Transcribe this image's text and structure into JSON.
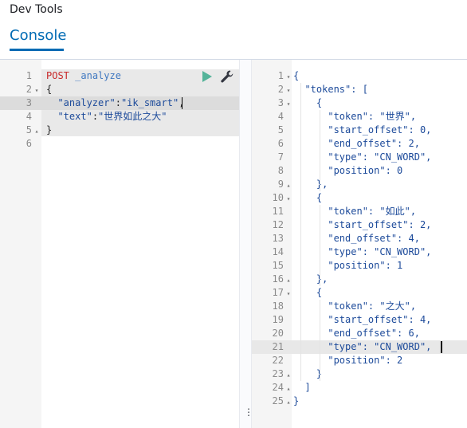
{
  "app": {
    "title": "Dev Tools"
  },
  "tabs": [
    {
      "label": "Console",
      "active": true
    }
  ],
  "request_editor": {
    "line_numbers": [
      "1",
      "2",
      "3",
      "4",
      "5",
      "6"
    ],
    "method": "POST",
    "endpoint": "_analyze",
    "line2": "{",
    "line3_key": "\"analyzer\"",
    "line3_sep": ":",
    "line3_val": "\"ik_smart\"",
    "line3_end": ",",
    "line4_key": "\"text\"",
    "line4_sep": ":",
    "line4_val": "\"世界如此之大\"",
    "line5": "}",
    "actions": {
      "run_icon": "play-icon",
      "settings_icon": "wrench-icon"
    }
  },
  "response_editor": {
    "line_numbers": [
      "1",
      "2",
      "3",
      "4",
      "5",
      "6",
      "7",
      "8",
      "9",
      "10",
      "11",
      "12",
      "13",
      "14",
      "15",
      "16",
      "17",
      "18",
      "19",
      "20",
      "21",
      "22",
      "23",
      "24",
      "25"
    ],
    "lines": [
      "{",
      "  \"tokens\": [",
      "    {",
      "      \"token\": \"世界\",",
      "      \"start_offset\": 0,",
      "      \"end_offset\": 2,",
      "      \"type\": \"CN_WORD\",",
      "      \"position\": 0",
      "    },",
      "    {",
      "      \"token\": \"如此\",",
      "      \"start_offset\": 2,",
      "      \"end_offset\": 4,",
      "      \"type\": \"CN_WORD\",",
      "      \"position\": 1",
      "    },",
      "    {",
      "      \"token\": \"之大\",",
      "      \"start_offset\": 4,",
      "      \"end_offset\": 6,",
      "      \"type\": \"CN_WORD\",",
      "      \"position\": 2",
      "    }",
      "  ]",
      "}"
    ]
  },
  "splitter": {
    "handle_glyph": "⋮"
  },
  "colors": {
    "accent": "#006bb4",
    "method": "#c82829",
    "url": "#4078c0",
    "run": "#54b399"
  }
}
